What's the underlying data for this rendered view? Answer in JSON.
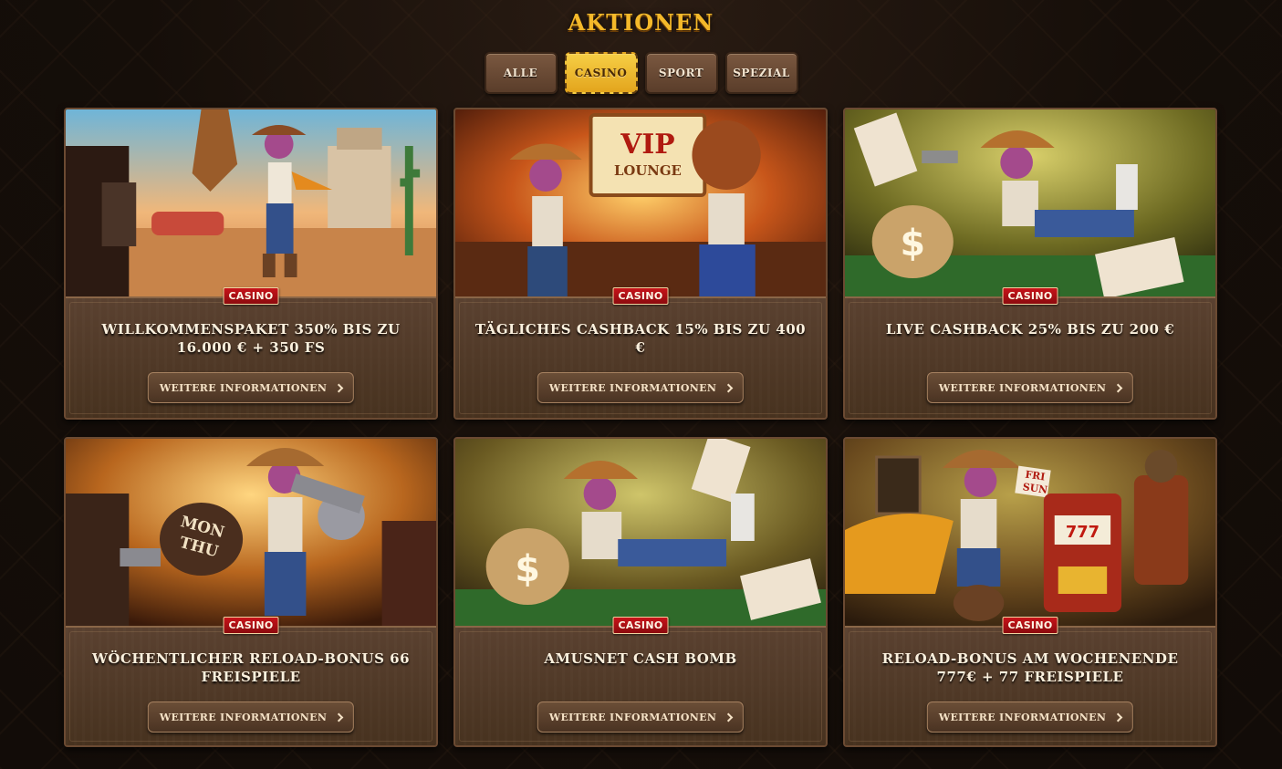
{
  "page": {
    "title": "AKTIONEN"
  },
  "filters": [
    {
      "label": "ALLE",
      "active": false
    },
    {
      "label": "CASINO",
      "active": true
    },
    {
      "label": "SPORT",
      "active": false
    },
    {
      "label": "SPEZIAL",
      "active": false
    }
  ],
  "promotions": [
    {
      "badge": "CASINO",
      "title": "WILLKOMMENSPAKET 350% BIS ZU 16.000 € + 350 FS",
      "button": "WEITERE INFORMATIONEN",
      "image_theme": "desert-street-showdown"
    },
    {
      "badge": "CASINO",
      "title": "TÄGLICHES CASHBACK 15% BIS ZU 400 €",
      "button": "WEITERE INFORMATIONEN",
      "image_theme": "vip-lounge-bar",
      "image_sign": "VIP",
      "image_sign_sub": "LOUNGE"
    },
    {
      "badge": "CASINO",
      "title": "LIVE CASHBACK 25% BIS ZU 200 €",
      "button": "WEITERE INFORMATIONEN",
      "image_theme": "poker-table-money-bag"
    },
    {
      "badge": "CASINO",
      "title": "WÖCHENTLICHER RELOAD-BONUS 66 FREISPIELE",
      "button": "WEITERE INFORMATIONEN",
      "image_theme": "saloon-gunfight",
      "image_sign": "MON",
      "image_sign_sub": "THU"
    },
    {
      "badge": "CASINO",
      "title": "AMUSNET CASH BOMB",
      "button": "WEITERE INFORMATIONEN",
      "image_theme": "poker-table-money-bag"
    },
    {
      "badge": "CASINO",
      "title": "RELOAD-BONUS AM WOCHENENDE 777€ + 77 FREISPIELE",
      "button": "WEITERE INFORMATIONEN",
      "image_theme": "slot-machine-robot",
      "image_sign": "FRI",
      "image_sign_sub": "SUN"
    }
  ],
  "colors": {
    "accent": "#f4b92a",
    "badge_red": "#c7141a",
    "card_bg": "#47321f",
    "page_bg": "#150e09"
  }
}
